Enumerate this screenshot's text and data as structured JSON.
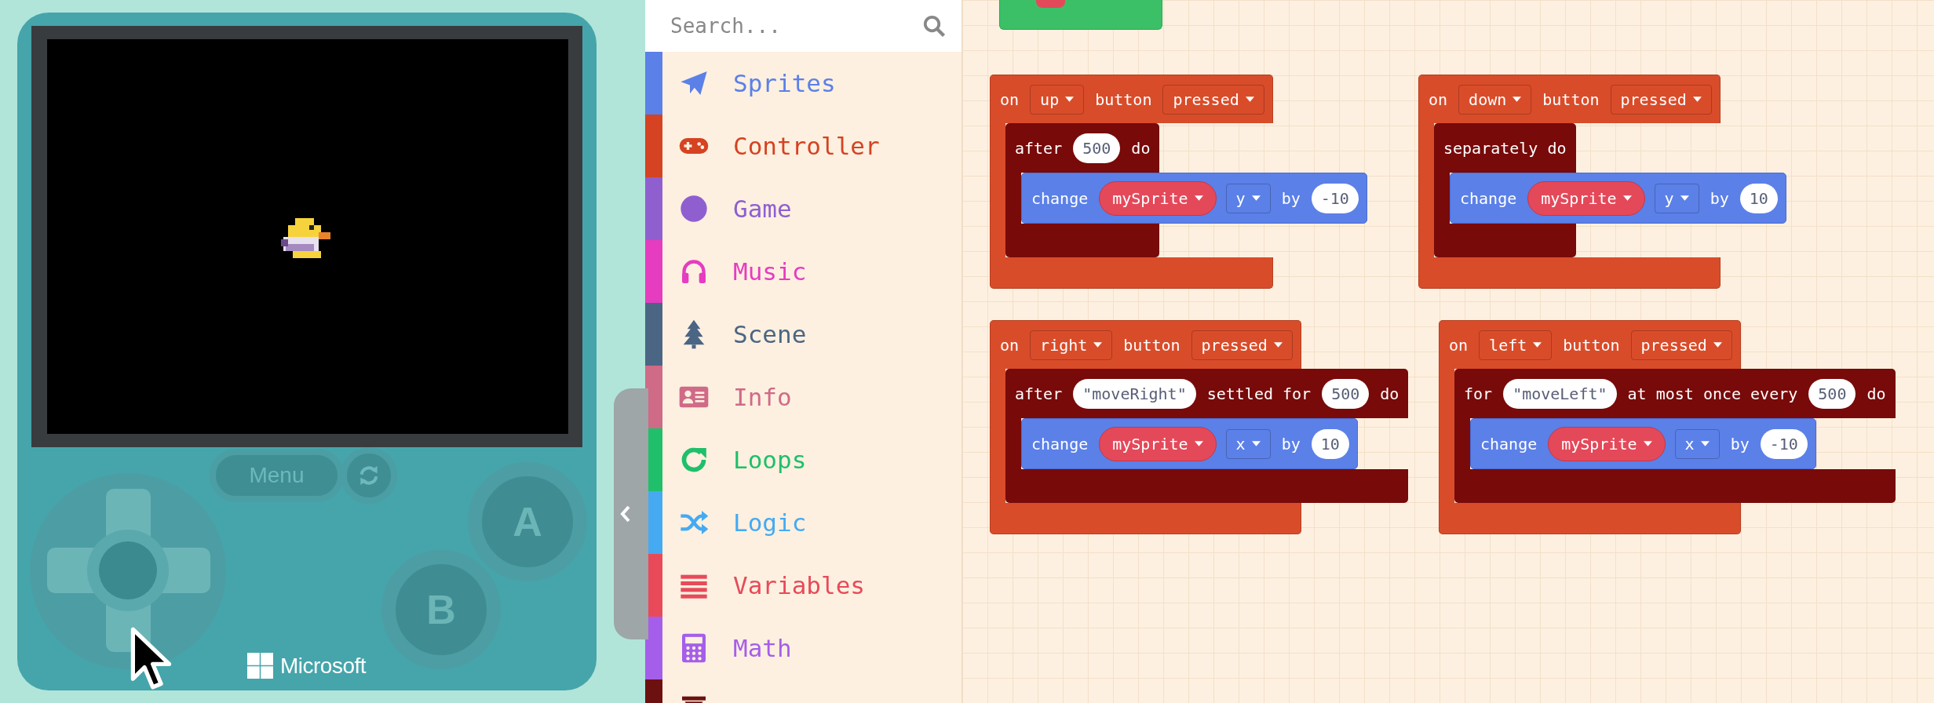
{
  "simulator": {
    "menu_button": "Menu",
    "buttons": [
      {
        "label": "A"
      },
      {
        "label": "B"
      }
    ],
    "brand": "Microsoft"
  },
  "toolbox": {
    "search": {
      "placeholder": "Search..."
    },
    "categories": [
      {
        "label": "Sprites",
        "color": "#5b80e8"
      },
      {
        "label": "Controller",
        "color": "#d54322"
      },
      {
        "label": "Game",
        "color": "#8f5fd0"
      },
      {
        "label": "Music",
        "color": "#e63cc0"
      },
      {
        "label": "Scene",
        "color": "#4b6584"
      },
      {
        "label": "Info",
        "color": "#cf6a87"
      },
      {
        "label": "Loops",
        "color": "#20bf6b"
      },
      {
        "label": "Logic",
        "color": "#45aaf2"
      },
      {
        "label": "Variables",
        "color": "#e84a5a"
      },
      {
        "label": "Math",
        "color": "#a55eea"
      },
      {
        "color": "#6d1010"
      }
    ]
  },
  "workspace": {
    "blocks": [
      {
        "event": [
          {
            "kind": "text",
            "text": "on"
          },
          {
            "kind": "dropdown",
            "text": "up"
          },
          {
            "kind": "text",
            "text": "button"
          },
          {
            "kind": "dropdown",
            "text": "pressed"
          }
        ],
        "inner": [
          {
            "kind": "text",
            "text": "after"
          },
          {
            "kind": "number",
            "text": "500"
          },
          {
            "kind": "text",
            "text": "do"
          }
        ],
        "statement": [
          {
            "kind": "text",
            "text": "change"
          },
          {
            "kind": "variable",
            "text": "mySprite"
          },
          {
            "kind": "dropdown",
            "text": "y"
          },
          {
            "kind": "text",
            "text": "by"
          },
          {
            "kind": "number",
            "text": "-10"
          }
        ]
      },
      {
        "event": [
          {
            "kind": "text",
            "text": "on"
          },
          {
            "kind": "dropdown",
            "text": "down"
          },
          {
            "kind": "text",
            "text": "button"
          },
          {
            "kind": "dropdown",
            "text": "pressed"
          }
        ],
        "inner": [
          {
            "kind": "text",
            "text": "separately do"
          }
        ],
        "statement": [
          {
            "kind": "text",
            "text": "change"
          },
          {
            "kind": "variable",
            "text": "mySprite"
          },
          {
            "kind": "dropdown",
            "text": "y"
          },
          {
            "kind": "text",
            "text": "by"
          },
          {
            "kind": "number",
            "text": "10"
          }
        ]
      },
      {
        "event": [
          {
            "kind": "text",
            "text": "on"
          },
          {
            "kind": "dropdown",
            "text": "right"
          },
          {
            "kind": "text",
            "text": "button"
          },
          {
            "kind": "dropdown",
            "text": "pressed"
          }
        ],
        "inner": [
          {
            "kind": "text",
            "text": "after"
          },
          {
            "kind": "string",
            "text": "\"moveRight\""
          },
          {
            "kind": "text",
            "text": "settled for"
          },
          {
            "kind": "number",
            "text": "500"
          },
          {
            "kind": "text",
            "text": "do"
          }
        ],
        "statement": [
          {
            "kind": "text",
            "text": "change"
          },
          {
            "kind": "variable",
            "text": "mySprite"
          },
          {
            "kind": "dropdown",
            "text": "x"
          },
          {
            "kind": "text",
            "text": "by"
          },
          {
            "kind": "number",
            "text": "10"
          }
        ]
      },
      {
        "event": [
          {
            "kind": "text",
            "text": "on"
          },
          {
            "kind": "dropdown",
            "text": "left"
          },
          {
            "kind": "text",
            "text": "button"
          },
          {
            "kind": "dropdown",
            "text": "pressed"
          }
        ],
        "inner": [
          {
            "kind": "text",
            "text": "for"
          },
          {
            "kind": "string",
            "text": "\"moveLeft\""
          },
          {
            "kind": "text",
            "text": "at most once every"
          },
          {
            "kind": "number",
            "text": "500"
          },
          {
            "kind": "text",
            "text": "do"
          }
        ],
        "statement": [
          {
            "kind": "text",
            "text": "change"
          },
          {
            "kind": "variable",
            "text": "mySprite"
          },
          {
            "kind": "dropdown",
            "text": "x"
          },
          {
            "kind": "text",
            "text": "by"
          },
          {
            "kind": "number",
            "text": "-10"
          }
        ]
      }
    ]
  }
}
